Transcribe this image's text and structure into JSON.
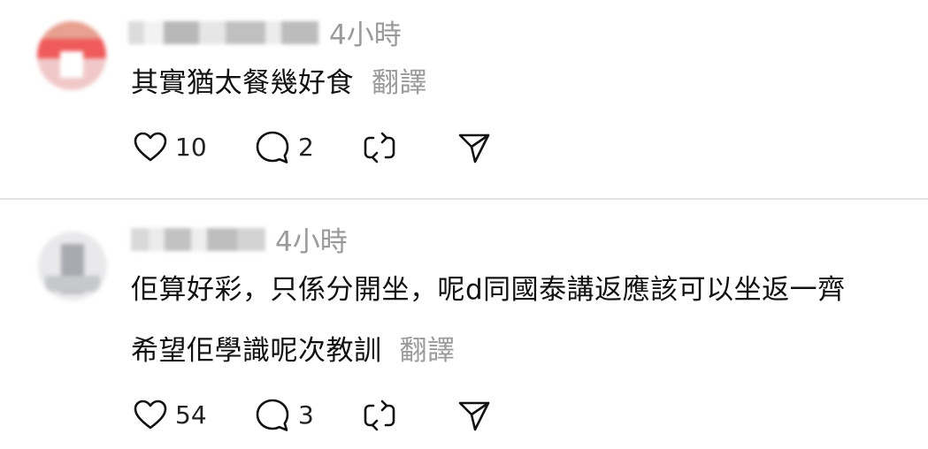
{
  "comments": [
    {
      "time": "4小時",
      "lines": [
        "其實猶太餐幾好食"
      ],
      "translate_label": "翻譯",
      "likes": "10",
      "replies": "2"
    },
    {
      "time": "4小時",
      "lines": [
        "佢算好彩，只係分開坐，呢d同國泰講返應該可以坐返一齊",
        "希望佢學識呢次教訓"
      ],
      "translate_label": "翻譯",
      "likes": "54",
      "replies": "3"
    }
  ],
  "icons": {
    "like": "heart-icon",
    "reply": "speech-bubble-icon",
    "repost": "repost-icon",
    "share": "send-icon"
  },
  "colors": {
    "text": "#111111",
    "muted": "#9a9a9a",
    "divider": "#e4e4e4"
  }
}
